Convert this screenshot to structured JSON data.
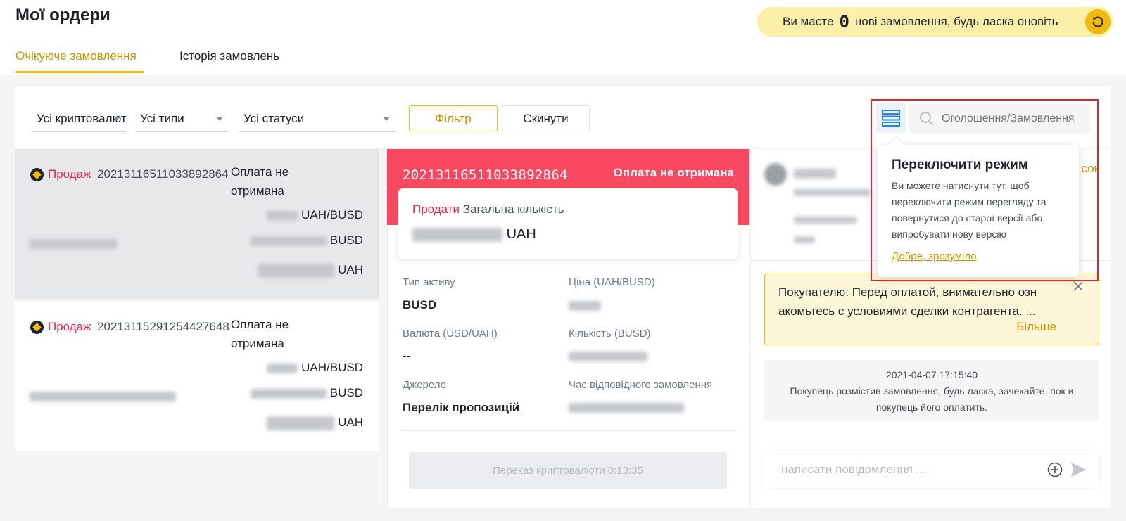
{
  "page": {
    "title": "Мої ордери",
    "tabs": [
      {
        "label": "Очікуюче замовлення"
      },
      {
        "label": "Історія замовлень"
      }
    ]
  },
  "notice": {
    "prefix": "Ви маєте",
    "count": "0",
    "suffix": "нові замовлення, будь ласка оновіть",
    "refresh_icon": "refresh-icon"
  },
  "filters": {
    "crypto": "Усі криптовалюти",
    "types": "Усі типи",
    "statuses": "Усі статуси",
    "filter_button": "Фільтр",
    "reset_button": "Скинути",
    "search_placeholder": "Оголошення/Замовлення"
  },
  "orders": [
    {
      "side": "Продаж",
      "number": "20213116511033892864",
      "status_line1": "Оплата не",
      "status_line2": "отримана",
      "price_unit": "UAH/BUSD",
      "amount_unit": "BUSD",
      "total_unit": "UAH"
    },
    {
      "side": "Продаж",
      "number": "20213115291254427648",
      "status_line1": "Оплата не",
      "status_line2": "отримана",
      "price_unit": "UAH/BUSD",
      "amount_unit": "BUSD",
      "total_unit": "UAH"
    }
  ],
  "detail": {
    "number": "20213116511033892864",
    "status": "Оплата не отримана",
    "side": "Продати",
    "total_label": "Загальна кількість",
    "total_unit": "UAH",
    "asset_type_label": "Тип активу",
    "asset_type": "BUSD",
    "price_label": "Ціна (UAH/BUSD)",
    "currency_label": "Валюта (USD/UAH)",
    "currency": "--",
    "quantity_label": "Кількість (BUSD)",
    "source_label": "Джерело",
    "source": "Перелік пропозицій",
    "match_time_label": "Час відповідного замовлення",
    "transfer_button": "Переказ криптовалюти 0:13:35"
  },
  "chat": {
    "alert_text": "Покупателю: Перед оплатой, внимательно озн акомьтесь с условиями сделки контрагента. ...",
    "alert_more": "Більше",
    "system_time": "2021-04-07 17:15:40",
    "system_text": "Покупець розмістив замовлення, будь ласка, зачекайте, пок и покупець його оплатить.",
    "input_placeholder": "написати повідомлення ...",
    "partial_link": "сок"
  },
  "tooltip": {
    "title": "Переключити режим",
    "body": "Ви можете натиснути тут, щоб переключити режим перегляду та повернутися до старої версії або випробувати нову версію",
    "ok": "Добре, зрозуміло"
  },
  "colors": {
    "accent": "#f0b90b",
    "accent_text": "#c99400",
    "sell": "#e0294a",
    "header_red": "#f84960",
    "highlight_box": "#e0252f"
  }
}
